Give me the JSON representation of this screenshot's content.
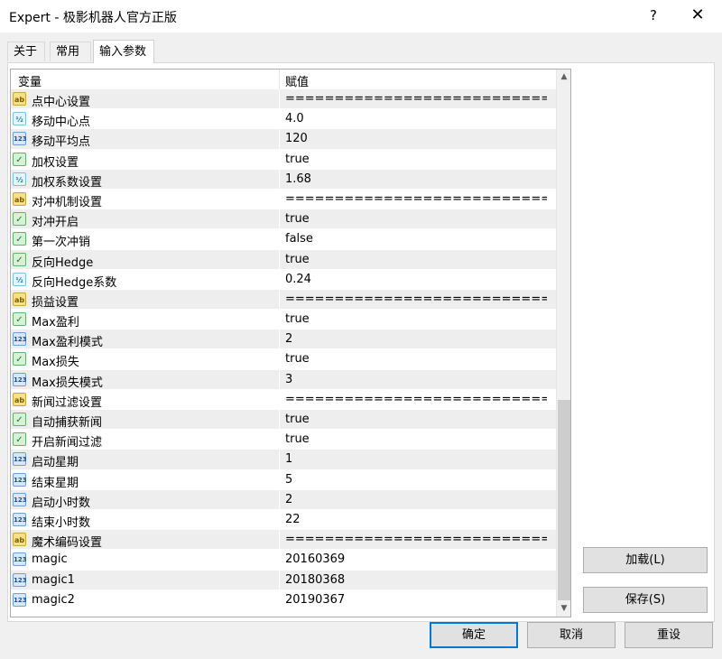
{
  "window": {
    "title": "Expert - 极影机器人官方正版",
    "help_glyph": "?",
    "close_glyph": "✕"
  },
  "tabs": [
    {
      "label": "关于"
    },
    {
      "label": "常用"
    },
    {
      "label": "输入参数",
      "active": true
    }
  ],
  "grid": {
    "headers": {
      "variable": "变量",
      "value": "赋值"
    },
    "rows": [
      {
        "type": "ab",
        "name": "点中心设置",
        "value": "==============================..."
      },
      {
        "type": "dbl",
        "name": "移动中心点",
        "value": "4.0"
      },
      {
        "type": "num",
        "name": "移动平均点",
        "value": "120"
      },
      {
        "type": "bool",
        "name": "加权设置",
        "value": "true"
      },
      {
        "type": "dbl",
        "name": "加权系数设置",
        "value": "1.68"
      },
      {
        "type": "ab",
        "name": "对冲机制设置",
        "value": "==============================..."
      },
      {
        "type": "bool",
        "name": "对冲开启",
        "value": "true"
      },
      {
        "type": "bool",
        "name": "第一次冲销",
        "value": "false"
      },
      {
        "type": "bool",
        "name": "反向Hedge",
        "value": "true"
      },
      {
        "type": "dbl",
        "name": "反向Hedge系数",
        "value": "0.24"
      },
      {
        "type": "ab",
        "name": "损益设置",
        "value": "==============================..."
      },
      {
        "type": "bool",
        "name": "Max盈利",
        "value": "true"
      },
      {
        "type": "num",
        "name": "Max盈利模式",
        "value": "2"
      },
      {
        "type": "bool",
        "name": "Max损失",
        "value": "true"
      },
      {
        "type": "num",
        "name": "Max损失模式",
        "value": "3"
      },
      {
        "type": "ab",
        "name": "新闻过滤设置",
        "value": "==============================..."
      },
      {
        "type": "bool",
        "name": "自动捕获新闻",
        "value": "true"
      },
      {
        "type": "bool",
        "name": "开启新闻过滤",
        "value": "true"
      },
      {
        "type": "num",
        "name": "启动星期",
        "value": "1"
      },
      {
        "type": "num",
        "name": "结束星期",
        "value": "5"
      },
      {
        "type": "num",
        "name": "启动小时数",
        "value": "2"
      },
      {
        "type": "num",
        "name": "结束小时数",
        "value": "22"
      },
      {
        "type": "ab",
        "name": "魔术编码设置",
        "value": "==============================..."
      },
      {
        "type": "num",
        "name": "magic",
        "value": "20160369"
      },
      {
        "type": "num",
        "name": "magic1",
        "value": "20180368"
      },
      {
        "type": "num",
        "name": "magic2",
        "value": "20190367"
      }
    ]
  },
  "icons": {
    "ab": "ab",
    "num": "123",
    "dbl": "½",
    "bool": "✓"
  },
  "side_buttons": {
    "load": "加载(L)",
    "save": "保存(S)"
  },
  "bottom_buttons": {
    "ok": "确定",
    "cancel": "取消",
    "reset": "重设"
  }
}
